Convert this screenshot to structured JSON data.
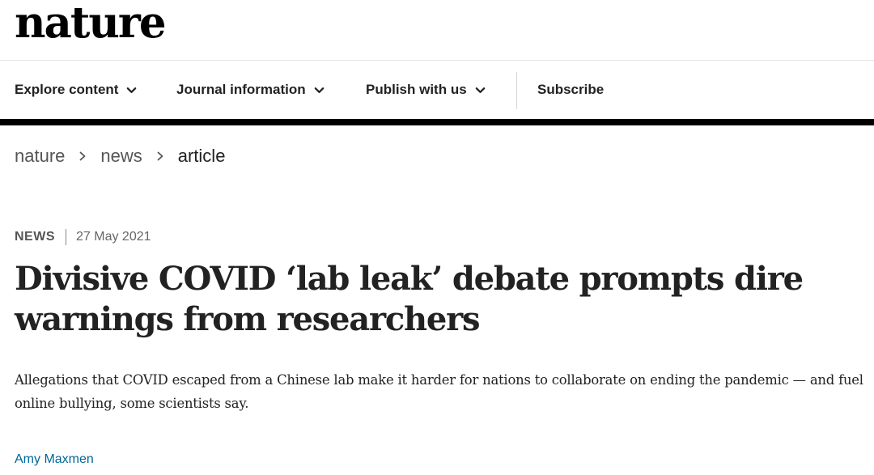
{
  "site": {
    "logo": "nature"
  },
  "nav": {
    "items": [
      {
        "label": "Explore content",
        "has_dropdown": true
      },
      {
        "label": "Journal information",
        "has_dropdown": true
      },
      {
        "label": "Publish with us",
        "has_dropdown": true
      },
      {
        "label": "Subscribe",
        "has_dropdown": false
      }
    ]
  },
  "breadcrumb": {
    "items": [
      "nature",
      "news",
      "article"
    ]
  },
  "article": {
    "type": "NEWS",
    "date": "27 May 2021",
    "title": "Divisive COVID ‘lab leak’ debate prompts dire warnings from researchers",
    "standfirst": "Allegations that COVID escaped from a Chinese lab make it harder for nations to collaborate on ending the pandemic — and fuel online bullying, some scientists say.",
    "author": "Amy Maxmen"
  },
  "colors": {
    "text": "#222222",
    "muted": "#555555",
    "link": "#006699",
    "rule": "#000000"
  },
  "icons": {
    "dropdown": "chevron-down-icon",
    "breadcrumb_separator": "chevron-right-icon"
  }
}
